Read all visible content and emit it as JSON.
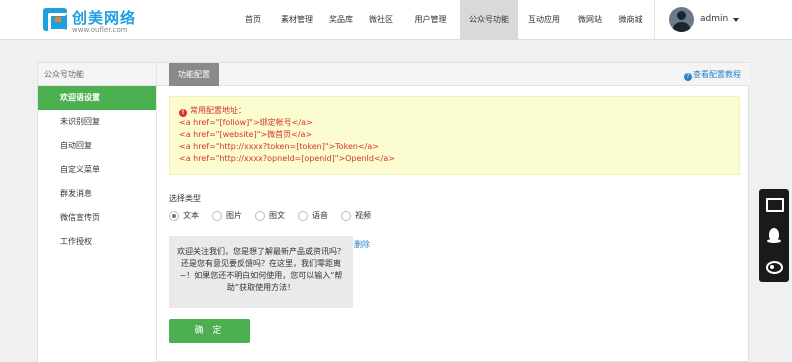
{
  "brand": {
    "name": "创美网络",
    "url": "www.oufler.com"
  },
  "nav": [
    {
      "label": "首页",
      "active": false
    },
    {
      "label": "素材管理",
      "active": false
    },
    {
      "label": "奖品库",
      "active": false
    },
    {
      "label": "微社区",
      "active": false
    },
    {
      "label": "用户管理",
      "active": false
    },
    {
      "label": "公众号功能",
      "active": true
    },
    {
      "label": "互动应用",
      "active": false
    },
    {
      "label": "微网站",
      "active": false
    },
    {
      "label": "微商城",
      "active": false
    }
  ],
  "user": {
    "name": "admin"
  },
  "sidebar": {
    "heading": "公众号功能",
    "items": [
      {
        "label": "欢迎语设置",
        "active": true
      },
      {
        "label": "未识别回复",
        "active": false
      },
      {
        "label": "自动回复",
        "active": false
      },
      {
        "label": "自定义菜单",
        "active": false
      },
      {
        "label": "群发消息",
        "active": false
      },
      {
        "label": "微信宣传页",
        "active": false
      },
      {
        "label": "工作授权",
        "active": false
      }
    ]
  },
  "tab": {
    "label": "功能配置"
  },
  "help_link": "查看配置教程",
  "notice": {
    "title": "常用配置地址：",
    "lines": [
      "<a href=\"[follow]\">绑定帐号</a>",
      "<a href=\"[website]\">微首页</a>",
      "<a href=\"http://xxxx?token=[token]\">Token</a>",
      "<a href=\"http://xxxx?opneId=[openid]\">OpenId</a>"
    ]
  },
  "type_label": "选择类型",
  "radio_options": [
    {
      "label": "文本",
      "checked": true
    },
    {
      "label": "图片",
      "checked": false
    },
    {
      "label": "图文",
      "checked": false
    },
    {
      "label": "语音",
      "checked": false
    },
    {
      "label": "视频",
      "checked": false
    }
  ],
  "welcome_message": "欢迎关注我们，您是想了解最新产品或资讯吗？还是您有意见要反馈吗？在这里，我们零距离~！如果您还不明白如何使用，您可以输入“帮助”获取使用方法！",
  "delete_label": "删除",
  "submit_label": "确 定",
  "colors": {
    "accent_green": "#4caf50",
    "link_blue": "#2a83c8",
    "notice_red": "#d9332a",
    "notice_bg": "#fbfcd0"
  },
  "float_toolbar": [
    "monitor-icon",
    "qq-icon",
    "weibo-icon"
  ]
}
